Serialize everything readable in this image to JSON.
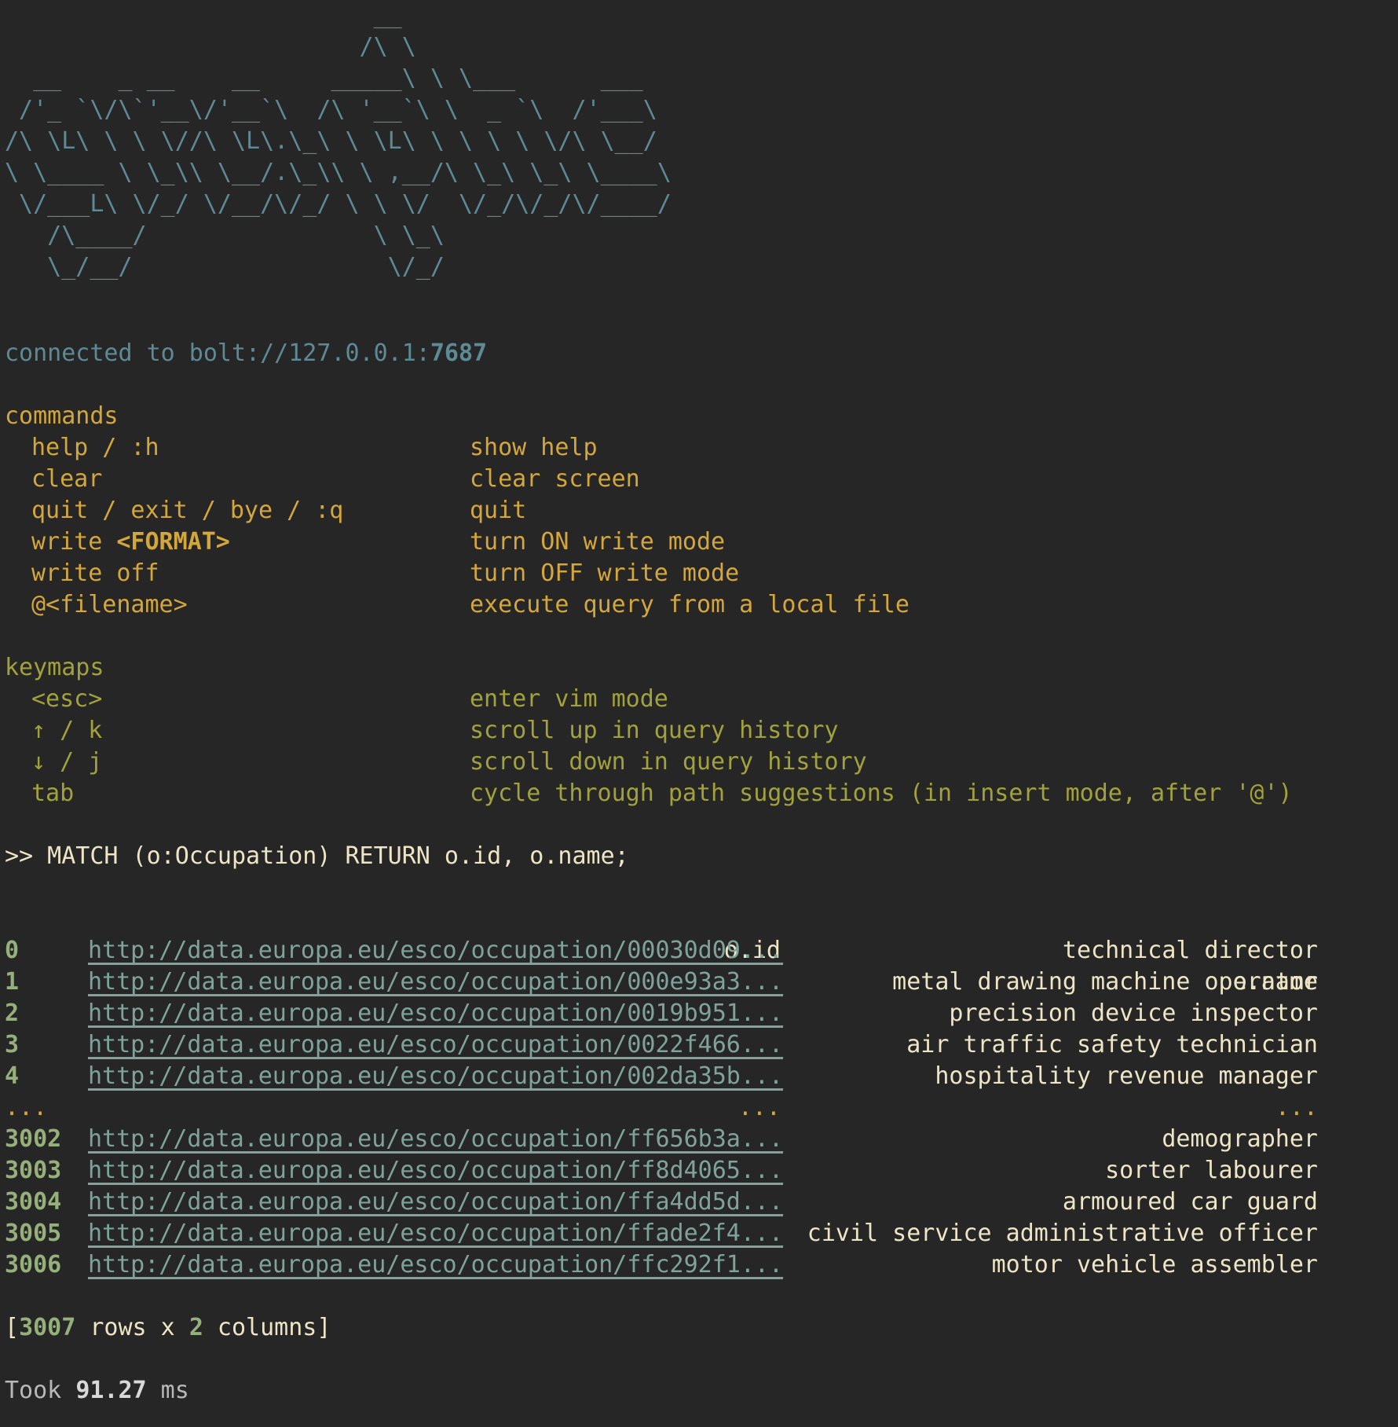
{
  "banner": "                          __\n                         /\\ \\\n  __    _ __    __     _____\\ \\ \\___      ___\n /'_ `\\/\\`'__\\/'__`\\  /\\ '__`\\ \\  _ `\\  /'___\\\n/\\ \\L\\ \\ \\ \\//\\ \\L\\.\\_\\ \\ \\L\\ \\ \\ \\ \\ \\/\\ \\__/\n\\ \\____ \\ \\_\\\\ \\__/.\\_\\\\ \\ ,__/\\ \\_\\ \\_\\ \\____\\\n \\/___L\\ \\/_/ \\/__/\\/_/ \\ \\ \\/  \\/_/\\/_/\\/____/\n   /\\____/                \\ \\_\\\n   \\_/__/                  \\/_/",
  "connection": {
    "prefix": "connected to bolt://127.0.0.1:",
    "port": "7687"
  },
  "commands": {
    "heading": "commands",
    "items": [
      {
        "key": "help / :h",
        "desc": "show help"
      },
      {
        "key": "clear",
        "desc": "clear screen"
      },
      {
        "key": "quit / exit / bye / :q",
        "desc": "quit"
      },
      {
        "key_prefix": "write ",
        "key_bold": "<FORMAT>",
        "desc": "turn ON write mode"
      },
      {
        "key": "write off",
        "desc": "turn OFF write mode"
      },
      {
        "key": "@<filename>",
        "desc": "execute query from a local file"
      }
    ]
  },
  "keymaps": {
    "heading": "keymaps",
    "items": [
      {
        "key": "<esc>",
        "desc": "enter vim mode"
      },
      {
        "key": "↑ / k",
        "desc": "scroll up in query history"
      },
      {
        "key": "↓ / j",
        "desc": "scroll down in query history"
      },
      {
        "key": "tab",
        "desc": "cycle through path suggestions (in insert mode, after '@')"
      }
    ]
  },
  "query": ">> MATCH (o:Occupation) RETURN o.id, o.name;",
  "results": {
    "columns": [
      "o.id",
      "o.name"
    ],
    "rows_top": [
      {
        "idx": "0",
        "id": "http://data.europa.eu/esco/occupation/00030d09...",
        "name": "technical director"
      },
      {
        "idx": "1",
        "id": "http://data.europa.eu/esco/occupation/000e93a3...",
        "name": "metal drawing machine operator"
      },
      {
        "idx": "2",
        "id": "http://data.europa.eu/esco/occupation/0019b951...",
        "name": "precision device inspector"
      },
      {
        "idx": "3",
        "id": "http://data.europa.eu/esco/occupation/0022f466...",
        "name": "air traffic safety technician"
      },
      {
        "idx": "4",
        "id": "http://data.europa.eu/esco/occupation/002da35b...",
        "name": "hospitality revenue manager"
      }
    ],
    "ellipsis": "...",
    "rows_bottom": [
      {
        "idx": "3002",
        "id": "http://data.europa.eu/esco/occupation/ff656b3a...",
        "name": "demographer"
      },
      {
        "idx": "3003",
        "id": "http://data.europa.eu/esco/occupation/ff8d4065...",
        "name": "sorter labourer"
      },
      {
        "idx": "3004",
        "id": "http://data.europa.eu/esco/occupation/ffa4dd5d...",
        "name": "armoured car guard"
      },
      {
        "idx": "3005",
        "id": "http://data.europa.eu/esco/occupation/ffade2f4...",
        "name": "civil service administrative officer"
      },
      {
        "idx": "3006",
        "id": "http://data.europa.eu/esco/occupation/ffc292f1...",
        "name": "motor vehicle assembler"
      }
    ]
  },
  "summary": {
    "open": "[",
    "rows": "3007",
    "mid": " rows x ",
    "cols": "2",
    "close": " columns]"
  },
  "timing": {
    "prefix": "Took ",
    "value": "91.27",
    "unit": " ms"
  }
}
